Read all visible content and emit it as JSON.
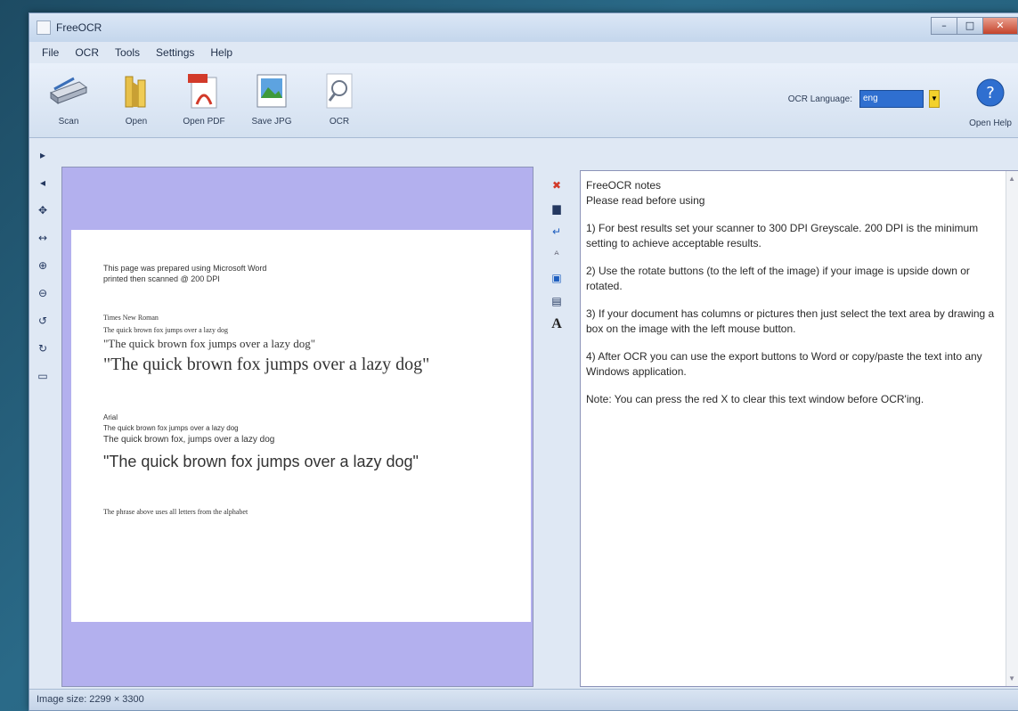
{
  "window": {
    "title": "FreeOCR",
    "controls": {
      "minimize": "–",
      "maximize": "□",
      "close": "✕"
    }
  },
  "menu": [
    "File",
    "OCR",
    "Tools",
    "Settings",
    "Help"
  ],
  "toolbar": {
    "scan": "Scan",
    "open": "Open",
    "open_pdf": "Open PDF",
    "save_jpg": "Save JPG",
    "ocr": "OCR",
    "ocr_language_label": "OCR Language:",
    "ocr_language_value": "eng",
    "open_help": "Open Help"
  },
  "document": {
    "intro_1": "This page was prepared using Microsoft Word",
    "intro_2": "printed then scanned @ 200 DPI",
    "times_heading": "Times New Roman",
    "times_small": "The quick brown fox jumps over a lazy dog",
    "times_medium": "\"The quick brown fox jumps over a lazy dog\"",
    "times_large": "\"The quick brown fox jumps over a lazy dog\"",
    "arial_heading": "Arial",
    "arial_small": "The quick brown fox jumps over a lazy dog",
    "arial_medium": "The quick brown fox, jumps over a lazy dog",
    "arial_large": "\"The quick brown fox jumps over a lazy dog\"",
    "footer": "The phrase above uses all letters from the alphabet"
  },
  "notes": {
    "title": "FreeOCR notes",
    "subtitle": "Please read before using",
    "p1": "1) For best results set your scanner to 300 DPI Greyscale. 200 DPI is the minimum setting to achieve acceptable results.",
    "p2": "2) Use the rotate buttons (to the left of the image) if your image is upside down or rotated.",
    "p3": "3) If your document has columns or pictures then just select the text area by drawing a box on the image with the left mouse button.",
    "p4": "4) After OCR you can use the export buttons to Word or copy/paste the text into any Windows application.",
    "p5": "Note: You can press the red X to clear this text window before OCR'ing."
  },
  "status": {
    "text": "Image size: 2299 × 3300"
  },
  "colors": {
    "image_bg": "#b3b0ee",
    "accent": "#2f6fd0",
    "clear_x": "#d23a2a"
  }
}
